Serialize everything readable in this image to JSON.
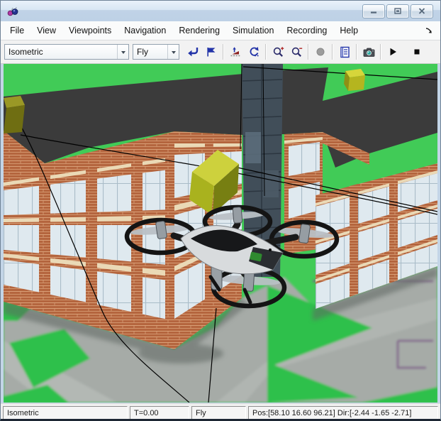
{
  "window": {
    "title": "",
    "app_icon": "simulink-3d-animation-viewer",
    "caption_buttons": [
      "minimize",
      "maximize",
      "close"
    ]
  },
  "menu": {
    "items": [
      {
        "label": "File"
      },
      {
        "label": "View"
      },
      {
        "label": "Viewpoints"
      },
      {
        "label": "Navigation"
      },
      {
        "label": "Rendering"
      },
      {
        "label": "Simulation"
      },
      {
        "label": "Recording"
      },
      {
        "label": "Help"
      }
    ],
    "overflow_icon": "menubar-overflow-arrow"
  },
  "toolbar": {
    "viewpoint_select": {
      "value": "Isometric"
    },
    "navigation_select": {
      "value": "Fly"
    },
    "icons": [
      "return-to-viewpoint",
      "create-viewpoint-flag",
      "straighten-up",
      "undo-move",
      "zoom-in",
      "zoom-out",
      "record-indicator",
      "editor-notes",
      "capture-frame-camera",
      "play",
      "stop"
    ]
  },
  "statusbar": {
    "viewpoint": "Isometric",
    "time": "T=0.00",
    "navigation": "Fly",
    "pose": "Pos:[58.10 16.60 96.21] Dir:[-2.44 -1.65 -2.71]"
  },
  "scene": {
    "objects": [
      "office-building",
      "quadcopter-drone",
      "waypoint-cube-left",
      "waypoint-cube-center",
      "waypoint-cube-roof",
      "trajectory-lines",
      "aerial-map-ground",
      "glass-curtain-wall"
    ],
    "colors": {
      "grass": "#41cb57",
      "roof": "#3b3b3b",
      "brick": "#b4653e",
      "glass_window": "#dfe9ef",
      "stone_band": "#ead9b6",
      "waypoint_yellow": "#cdd13d",
      "ground_gray": "#a6aba7",
      "map_outline_purple": "#7d5c87",
      "curtain_wall": "#414e59"
    }
  },
  "colors": {
    "titlebar_top": "#e9f1fa",
    "titlebar_bottom": "#bed1e6",
    "icon_blue": "#2233a8",
    "toolbar_bg": "#f2f2f2",
    "status_bg": "#f0f0f0",
    "frame": "#c3d5e7"
  }
}
